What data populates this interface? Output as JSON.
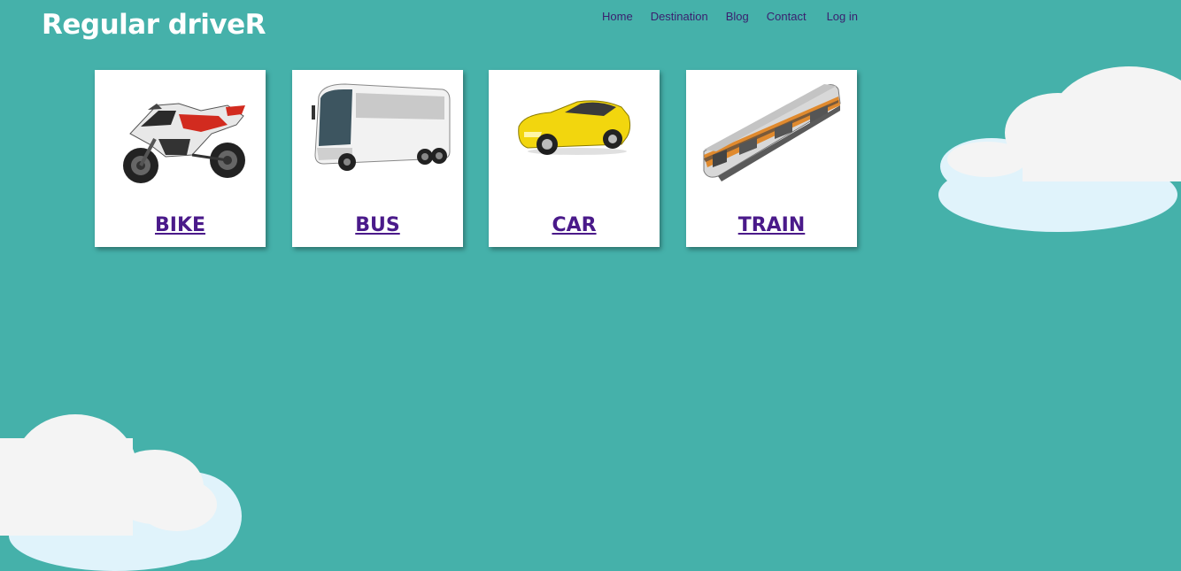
{
  "brand": {
    "title": "Regular driveR"
  },
  "nav": {
    "items": [
      {
        "label": "Home"
      },
      {
        "label": "Destination"
      },
      {
        "label": "Blog"
      },
      {
        "label": "Contact"
      },
      {
        "label": "Log in"
      }
    ]
  },
  "cards": [
    {
      "label": "BIKE",
      "icon": "motorcycle-icon"
    },
    {
      "label": "BUS",
      "icon": "bus-icon"
    },
    {
      "label": "CAR",
      "icon": "car-icon"
    },
    {
      "label": "TRAIN",
      "icon": "train-icon"
    }
  ],
  "colors": {
    "background": "#45b1aa",
    "card_label": "#4a1a8a",
    "nav_link": "#3b1f6e",
    "brand_text": "#ffffff"
  }
}
